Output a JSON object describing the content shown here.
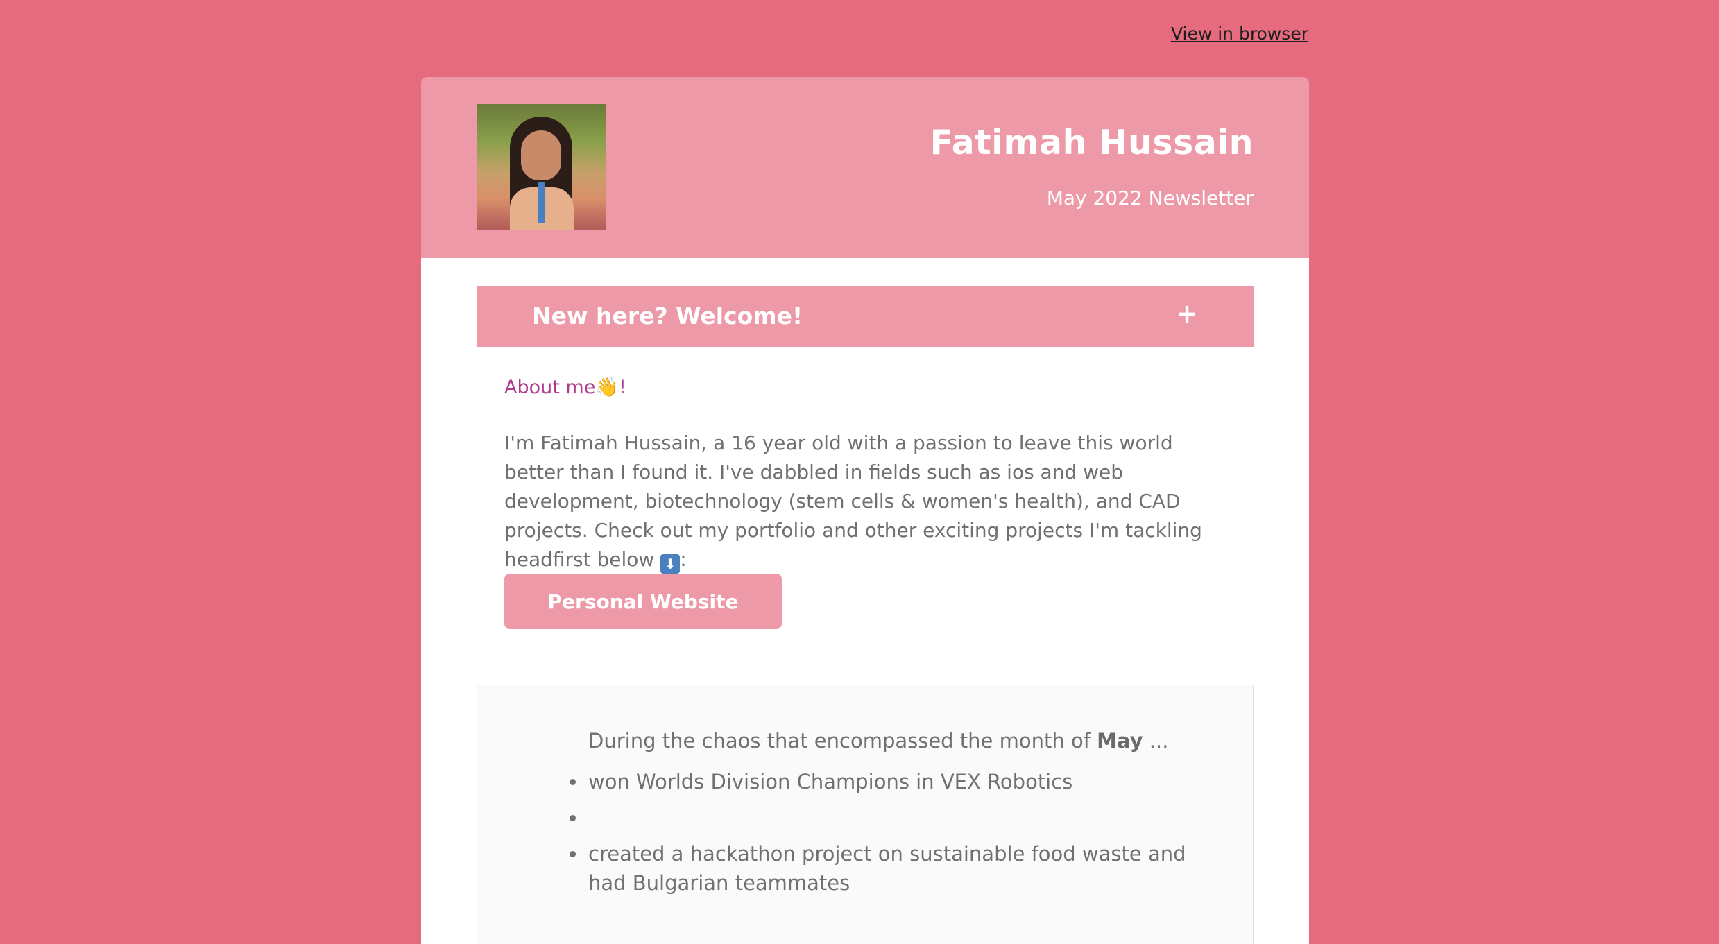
{
  "top_link": "View in browser",
  "header": {
    "name": "Fatimah Hussain",
    "subtitle": "May 2022 Newsletter"
  },
  "accordion": {
    "title": "New here? Welcome!",
    "toggle": "+"
  },
  "about": {
    "heading": "About me👋!",
    "bio_text": "I'm Fatimah Hussain, a 16 year old with a passion to leave this world better than I found it. I've dabbled in fields such as ios and web development, biotechnology (stem cells & women's health), and CAD projects. Check out my portfolio and other exciting projects I'm tackling headfirst below ",
    "bio_emoji": "⬇",
    "bio_end": ":",
    "button": "Personal Website"
  },
  "panel": {
    "intro_before": "During the chaos that encompassed the month of ",
    "intro_bold": "May",
    "intro_after": " ...",
    "items": [
      "won Worlds Division Champions in VEX Robotics",
      "",
      "created a hackathon project on sustainable food waste and had Bulgarian teammates"
    ]
  },
  "colors": {
    "background": "#e66b7e",
    "accent_pink": "#ed99a8",
    "about_heading": "#b03c8f"
  }
}
